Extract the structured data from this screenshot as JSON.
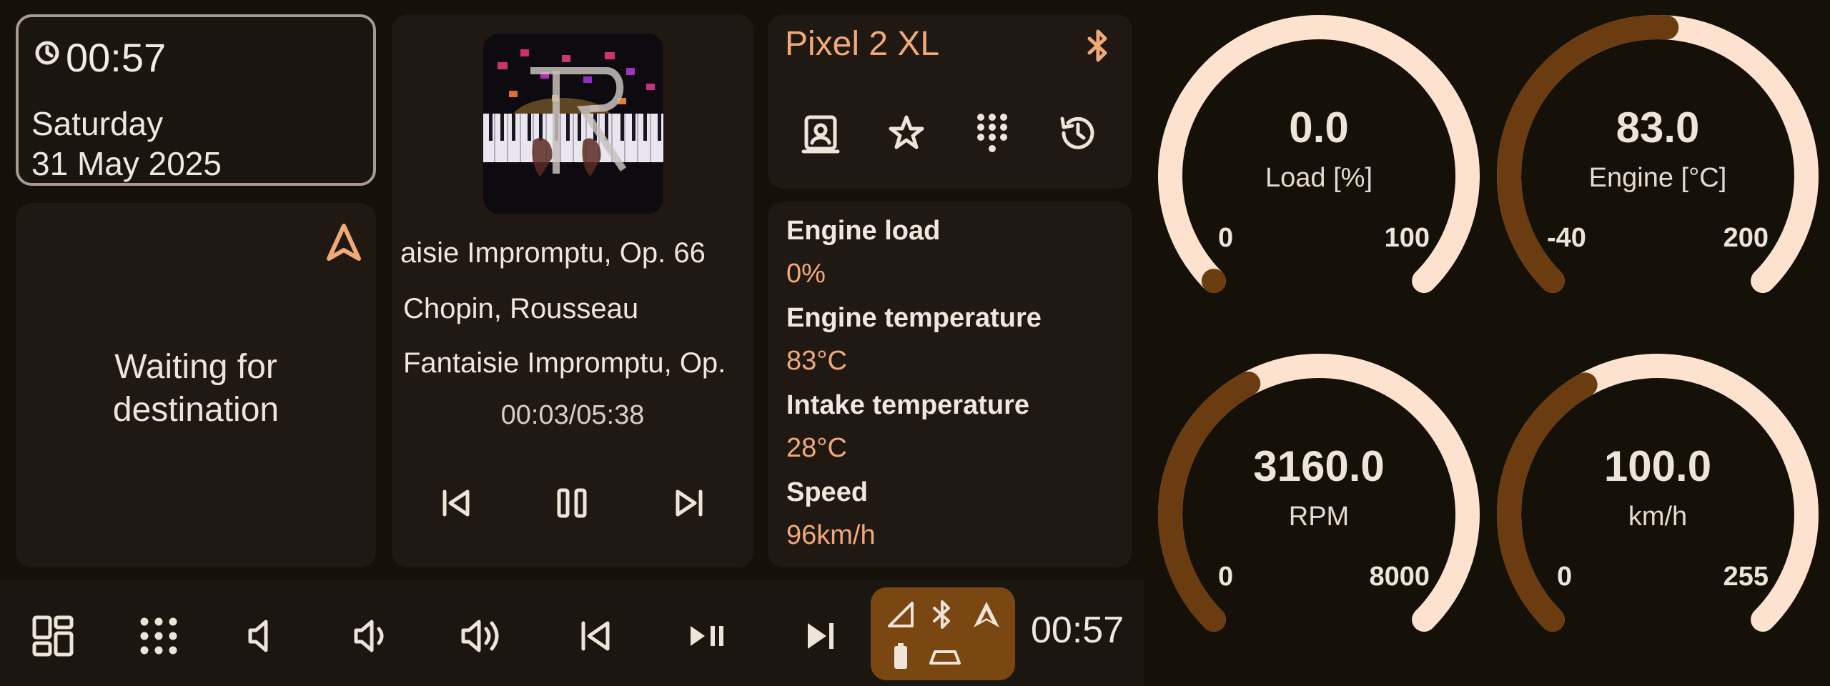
{
  "clock": {
    "time": "00:57",
    "day": "Saturday",
    "date": "31 May 2025"
  },
  "navigation": {
    "status": "Waiting for destination"
  },
  "media": {
    "title": "aisie Impromptu, Op. 66",
    "artist": "Chopin, Rousseau",
    "album": "Fantaisie Impromptu, Op.",
    "position": "00:03/05:38"
  },
  "phone": {
    "device": "Pixel 2 XL"
  },
  "obd": [
    {
      "label": "Engine load",
      "value": "0%"
    },
    {
      "label": "Engine temperature",
      "value": "83°C"
    },
    {
      "label": "Intake temperature",
      "value": "28°C"
    },
    {
      "label": "Speed",
      "value": "96km/h"
    }
  ],
  "gauges": [
    {
      "id": "load",
      "value": "0.0",
      "unit": "Load [%]",
      "min": "0",
      "max": "100",
      "fraction": 0.0
    },
    {
      "id": "engine",
      "value": "83.0",
      "unit": "Engine [°C]",
      "min": "-40",
      "max": "200",
      "fraction": 0.5125
    },
    {
      "id": "rpm",
      "value": "3160.0",
      "unit": "RPM",
      "min": "0",
      "max": "8000",
      "fraction": 0.395
    },
    {
      "id": "speed",
      "value": "100.0",
      "unit": "km/h",
      "min": "0",
      "max": "255",
      "fraction": 0.392
    }
  ],
  "bottom_bar": {
    "time": "00:57"
  },
  "colors": {
    "accent": "#f2a978",
    "gauge_track": "#fde3cf",
    "gauge_fill": "#6b3c10",
    "pill": "#7a4612"
  }
}
